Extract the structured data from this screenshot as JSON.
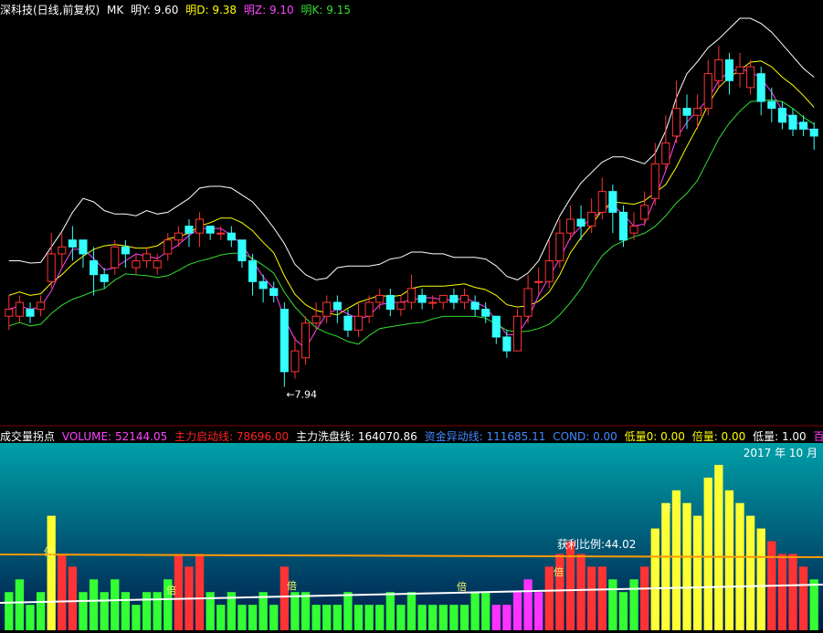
{
  "header": {
    "stock": "深科技(日线,前复权)",
    "indicator": "MK",
    "items": [
      {
        "label": "明Y: 9.60",
        "color": "#ffffff"
      },
      {
        "label": "明D: 9.38",
        "color": "#ffff00"
      },
      {
        "label": "明Z: 9.10",
        "color": "#ff44ff"
      },
      {
        "label": "明K: 9.15",
        "color": "#33dd33"
      }
    ]
  },
  "sub_header": {
    "title": "成交量拐点",
    "items": [
      {
        "label": "VOLUME: 52144.05",
        "color": "#ff44ff"
      },
      {
        "label": "主力启动线: 78696.00",
        "color": "#ff2222"
      },
      {
        "label": "主力洗盘线: 164070.86",
        "color": "#ffffff"
      },
      {
        "label": "资金异动线: 111685.11",
        "color": "#4488ff"
      },
      {
        "label": "COND: 0.00",
        "color": "#4488ff"
      },
      {
        "label": "低量0: 0.00",
        "color": "#ffff00"
      },
      {
        "label": "倍量: 0.00",
        "color": "#ffff00"
      },
      {
        "label": "低量: 1.00",
        "color": "#ffffff"
      },
      {
        "label": "百日低",
        "color": "#ff44ff"
      }
    ]
  },
  "date_label": "2017 年 10 月",
  "annotations": {
    "low_price": "7.94",
    "profit_ratio": "获利比例:44.02",
    "multiple_mark": "倍"
  },
  "chart_data": [
    {
      "type": "candlestick",
      "series": [
        {
          "name": "明Y",
          "color": "#ffffff"
        },
        {
          "name": "明D",
          "color": "#ffff00"
        },
        {
          "name": "明Z",
          "color": "#ff44ff"
        },
        {
          "name": "明K",
          "color": "#33dd33"
        }
      ],
      "candles": [
        [
          8.45,
          8.5,
          8.35,
          8.6
        ],
        [
          8.45,
          8.55,
          8.4,
          8.6
        ],
        [
          8.5,
          8.45,
          8.4,
          8.55
        ],
        [
          8.5,
          8.55,
          8.45,
          8.6
        ],
        [
          8.7,
          8.9,
          8.65,
          9.05
        ],
        [
          8.9,
          8.95,
          8.8,
          9.05
        ],
        [
          9.0,
          8.95,
          8.85,
          9.1
        ],
        [
          9.0,
          8.9,
          8.8,
          9.0
        ],
        [
          8.85,
          8.75,
          8.6,
          8.95
        ],
        [
          8.75,
          8.7,
          8.65,
          8.8
        ],
        [
          8.8,
          8.95,
          8.75,
          9.0
        ],
        [
          8.95,
          8.9,
          8.8,
          9.0
        ],
        [
          8.8,
          8.85,
          8.75,
          8.9
        ],
        [
          8.85,
          8.9,
          8.8,
          8.95
        ],
        [
          8.8,
          8.85,
          8.75,
          8.9
        ],
        [
          8.9,
          9.0,
          8.85,
          9.05
        ],
        [
          9.0,
          9.05,
          8.95,
          9.1
        ],
        [
          9.1,
          9.05,
          8.95,
          9.15
        ],
        [
          9.05,
          9.15,
          8.95,
          9.2
        ],
        [
          9.1,
          9.05,
          9.0,
          9.1
        ],
        [
          9.05,
          9.05,
          9.0,
          9.1
        ],
        [
          9.05,
          9.0,
          8.95,
          9.1
        ],
        [
          9.0,
          8.85,
          8.8,
          9.0
        ],
        [
          8.85,
          8.7,
          8.6,
          8.9
        ],
        [
          8.7,
          8.65,
          8.55,
          8.75
        ],
        [
          8.65,
          8.6,
          8.55,
          8.7
        ],
        [
          8.5,
          8.05,
          7.94,
          8.55
        ],
        [
          8.05,
          8.2,
          8.0,
          8.3
        ],
        [
          8.15,
          8.4,
          8.1,
          8.45
        ],
        [
          8.4,
          8.45,
          8.35,
          8.55
        ],
        [
          8.45,
          8.55,
          8.4,
          8.6
        ],
        [
          8.55,
          8.5,
          8.4,
          8.6
        ],
        [
          8.45,
          8.35,
          8.3,
          8.5
        ],
        [
          8.35,
          8.45,
          8.3,
          8.55
        ],
        [
          8.45,
          8.55,
          8.4,
          8.6
        ],
        [
          8.55,
          8.6,
          8.5,
          8.65
        ],
        [
          8.6,
          8.5,
          8.45,
          8.65
        ],
        [
          8.5,
          8.55,
          8.45,
          8.6
        ],
        [
          8.55,
          8.65,
          8.5,
          8.75
        ],
        [
          8.6,
          8.55,
          8.5,
          8.65
        ],
        [
          8.55,
          8.55,
          8.5,
          8.6
        ],
        [
          8.55,
          8.6,
          8.5,
          8.6
        ],
        [
          8.6,
          8.55,
          8.5,
          8.65
        ],
        [
          8.55,
          8.6,
          8.5,
          8.65
        ],
        [
          8.55,
          8.5,
          8.45,
          8.6
        ],
        [
          8.5,
          8.45,
          8.4,
          8.55
        ],
        [
          8.45,
          8.3,
          8.25,
          8.45
        ],
        [
          8.3,
          8.2,
          8.15,
          8.35
        ],
        [
          8.2,
          8.45,
          8.2,
          8.5
        ],
        [
          8.45,
          8.65,
          8.4,
          8.75
        ],
        [
          8.7,
          8.7,
          8.6,
          8.8
        ],
        [
          8.7,
          8.85,
          8.65,
          9.0
        ],
        [
          8.85,
          9.05,
          8.8,
          9.15
        ],
        [
          9.05,
          9.15,
          9.0,
          9.25
        ],
        [
          9.15,
          9.1,
          9.0,
          9.25
        ],
        [
          9.1,
          9.2,
          9.05,
          9.3
        ],
        [
          9.2,
          9.35,
          9.15,
          9.45
        ],
        [
          9.35,
          9.2,
          9.05,
          9.4
        ],
        [
          9.2,
          9.0,
          8.95,
          9.25
        ],
        [
          9.05,
          9.1,
          9.0,
          9.2
        ],
        [
          9.15,
          9.25,
          9.1,
          9.35
        ],
        [
          9.3,
          9.55,
          9.25,
          9.7
        ],
        [
          9.55,
          9.7,
          9.5,
          9.9
        ],
        [
          9.75,
          9.95,
          9.7,
          10.15
        ],
        [
          9.95,
          9.9,
          9.8,
          10.05
        ],
        [
          9.9,
          9.95,
          9.8,
          10.05
        ],
        [
          9.95,
          10.2,
          9.9,
          10.3
        ],
        [
          10.15,
          10.3,
          10.1,
          10.4
        ],
        [
          10.3,
          10.15,
          10.05,
          10.35
        ],
        [
          10.2,
          10.25,
          10.1,
          10.35
        ],
        [
          10.1,
          10.25,
          10.05,
          10.3
        ],
        [
          10.2,
          10.0,
          9.9,
          10.25
        ],
        [
          10.0,
          9.95,
          9.85,
          10.1
        ],
        [
          9.95,
          9.85,
          9.8,
          10.0
        ],
        [
          9.9,
          9.8,
          9.75,
          9.95
        ],
        [
          9.85,
          9.8,
          9.75,
          9.9
        ],
        [
          9.8,
          9.75,
          9.65,
          9.85
        ]
      ],
      "low_label": 7.94
    },
    {
      "type": "bar",
      "lines": [
        {
          "name": "主力启动线",
          "color": "#ff2222"
        },
        {
          "name": "主力洗盘线",
          "color": "#ffffff"
        }
      ],
      "volume": [
        3,
        4,
        2,
        3,
        9,
        6,
        5,
        3,
        4,
        3,
        4,
        3,
        2,
        3,
        3,
        4,
        6,
        5,
        6,
        3,
        2,
        3,
        2,
        2,
        3,
        2,
        5,
        3,
        3,
        2,
        2,
        2,
        3,
        2,
        2,
        2,
        3,
        2,
        3,
        2,
        2,
        2,
        2,
        2,
        3,
        3,
        2,
        2,
        3,
        4,
        3,
        5,
        6,
        7,
        6,
        5,
        5,
        4,
        3,
        4,
        5,
        8,
        10,
        11,
        10,
        9,
        12,
        13,
        11,
        10,
        9,
        8,
        7,
        6,
        6,
        5,
        4
      ],
      "startLine": 78696.0,
      "washLine": 164070.86
    }
  ]
}
